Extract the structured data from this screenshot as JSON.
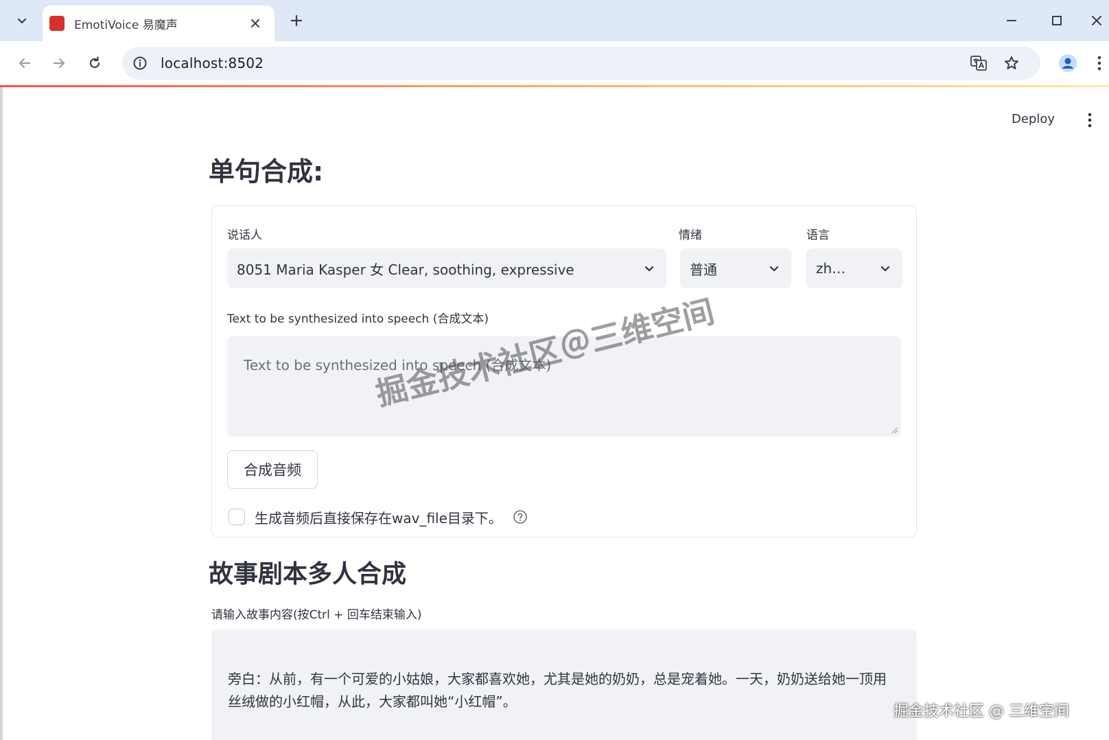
{
  "browser": {
    "tab_title": "EmotiVoice 易魔声",
    "url": "localhost:8502"
  },
  "app": {
    "deploy_label": "Deploy",
    "single": {
      "heading": "单句合成:",
      "speaker_label": "说话人",
      "speaker_value": "8051 Maria Kasper 女 Clear, soothing, expressive",
      "emotion_label": "情绪",
      "emotion_value": "普通",
      "language_label": "语言",
      "language_value": "zh…",
      "text_label": "Text to be synthesized into speech (合成文本)",
      "text_placeholder": "Text to be synthesized into speech (合成文本)",
      "synth_button": "合成音频",
      "save_checkbox_label": "生成音频后直接保存在wav_file目录下。"
    },
    "story": {
      "heading": "故事剧本多人合成",
      "input_label": "请输入故事内容(按Ctrl + 回车结束输入)",
      "input_text": "旁白：从前，有一个可爱的小姑娘，大家都喜欢她，尤其是她的奶奶，总是宠着她。一天，奶奶送给她一顶用丝绒做的小红帽，从此，大家都叫她“小红帽”。"
    }
  },
  "watermark": {
    "center": "掘金技术社区＠三维空间",
    "corner": "掘金技术社区 @ 三维空间"
  },
  "colors": {
    "accent": "#ff4b4b",
    "tab_strip": "#dfe8f7",
    "input_bg": "#f0f2f6",
    "text": "#31333f"
  }
}
